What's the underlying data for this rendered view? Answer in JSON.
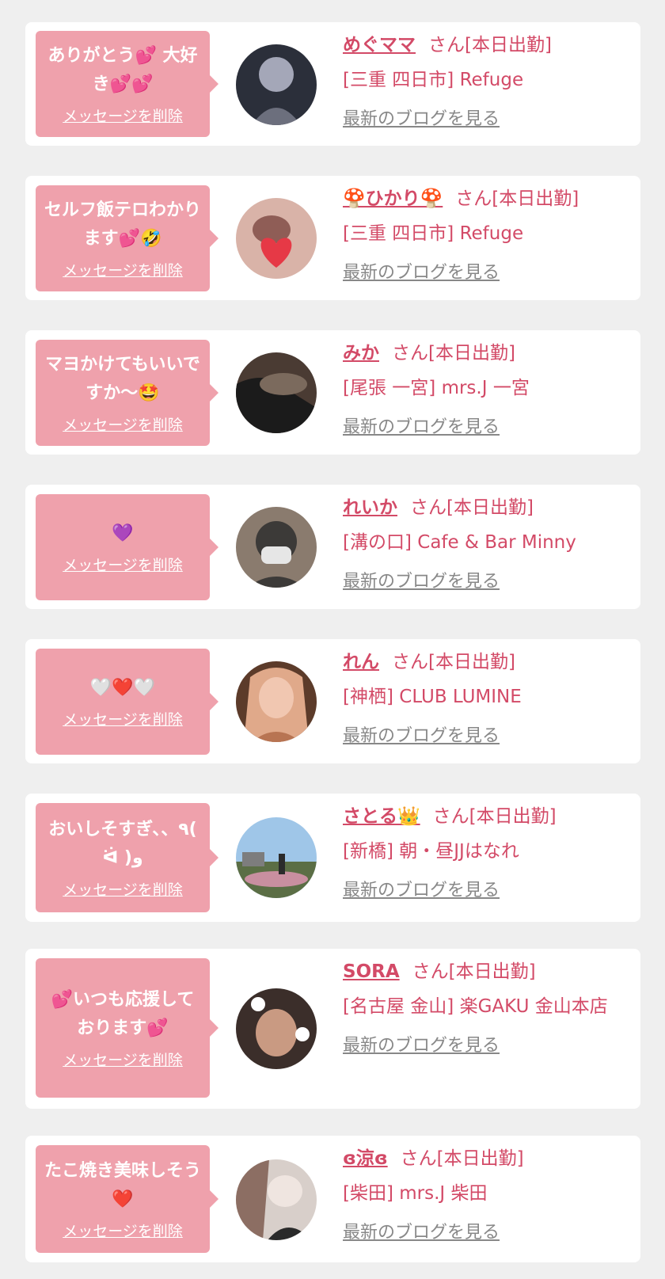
{
  "accent_color": "#d34a67",
  "bubble_color": "#efa1ac",
  "items": [
    {
      "message": "ありがとう💕 大好き💕💕",
      "delete_label": "メッセージを削除",
      "name": "めぐママ",
      "name_suffix": "さん[本日出勤]",
      "shop": "[三重 四日市] Refuge",
      "blog_label": "最新のブログを見る",
      "avatar_colors": [
        "#2b2f3a",
        "#6c6f7d",
        "#a4a7b8"
      ]
    },
    {
      "message": "セルフ飯テロわかります💕🤣",
      "delete_label": "メッセージを削除",
      "name": "🍄ひかり🍄",
      "name_suffix": "さん[本日出勤]",
      "shop": "[三重 四日市] Refuge",
      "blog_label": "最新のブログを見る",
      "avatar_colors": [
        "#d9b3a8",
        "#8f5d56",
        "#e63946"
      ]
    },
    {
      "message": "マヨかけてもいいですか～🤩",
      "delete_label": "メッセージを削除",
      "name": "みか",
      "name_suffix": "さん[本日出勤]",
      "shop": "[尾張 一宮] mrs.J 一宮",
      "blog_label": "最新のブログを見る",
      "avatar_colors": [
        "#1b1b1b",
        "#4a3b33",
        "#7b6a5d"
      ]
    },
    {
      "message": "💜",
      "delete_label": "メッセージを削除",
      "name": "れいか",
      "name_suffix": "さん[本日出勤]",
      "shop": "[溝の口] Cafe & Bar Minny",
      "blog_label": "最新のブログを見る",
      "avatar_colors": [
        "#3c3a38",
        "#e6e6e6",
        "#8a7b6e"
      ]
    },
    {
      "message": "🤍❤️🤍",
      "delete_label": "メッセージを削除",
      "name": "れん",
      "name_suffix": "さん[本日出勤]",
      "shop": "[神栖] CLUB LUMINE",
      "blog_label": "最新のブログを見る",
      "avatar_colors": [
        "#e0a98a",
        "#b87452",
        "#5c3b2a"
      ]
    },
    {
      "message": "おいしそすぎ、、٩( ᐛ )و",
      "delete_label": "メッセージを削除",
      "name": "さとる👑",
      "name_suffix": "さん[本日出勤]",
      "shop": "[新橋] 朝・昼JJはなれ",
      "blog_label": "最新のブログを見る",
      "avatar_colors": [
        "#9fc6e8",
        "#c98fa0",
        "#5b6e45"
      ]
    },
    {
      "message": "💕いつも応援しております💕",
      "delete_label": "メッセージを削除",
      "name": "SORA",
      "name_suffix": "さん[本日出勤]",
      "shop": "[名古屋 金山] 楽GAKU 金山本店",
      "blog_label": "最新のブログを見る",
      "avatar_colors": [
        "#3b2e2a",
        "#c99a82",
        "#ffffff"
      ]
    },
    {
      "message": "たこ焼き美味しそう❤️",
      "delete_label": "メッセージを削除",
      "name": "ɞ涼ɞ",
      "name_suffix": "さん[本日出勤]",
      "shop": "[柴田] mrs.J 柴田",
      "blog_label": "最新のブログを見る",
      "avatar_colors": [
        "#d8cfca",
        "#8c6e63",
        "#2a2a2a"
      ]
    }
  ]
}
